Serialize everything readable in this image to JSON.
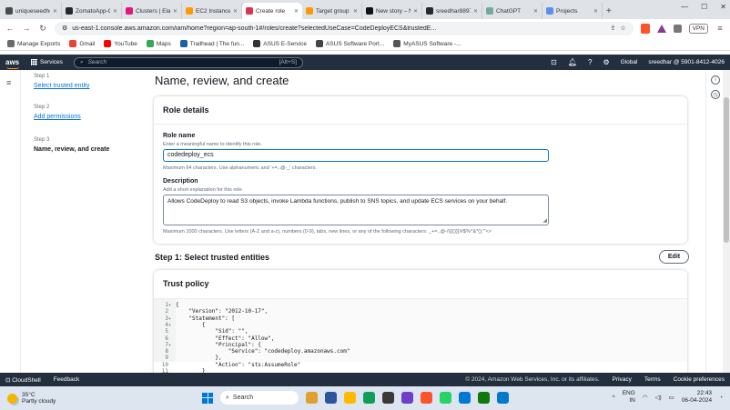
{
  "browser": {
    "tabs": [
      {
        "title": "uniqueseedhe",
        "color": "#4a4a4a",
        "active": false
      },
      {
        "title": "ZomatoApp-C",
        "color": "#24292e",
        "active": false
      },
      {
        "title": "Clusters | Elasti",
        "color": "#e7157b",
        "active": false
      },
      {
        "title": "EC2 Instance C",
        "color": "#ff9900",
        "active": false
      },
      {
        "title": "Create role",
        "color": "#dd344c",
        "active": true
      },
      {
        "title": "Target group d",
        "color": "#ff9900",
        "active": false
      },
      {
        "title": "New story – Me",
        "color": "#111111",
        "active": false
      },
      {
        "title": "sreedhar8897/",
        "color": "#24292e",
        "active": false
      },
      {
        "title": "ChatGPT",
        "color": "#74aa9c",
        "active": false
      },
      {
        "title": "Projects",
        "color": "#5b8def",
        "active": false
      }
    ],
    "url": "us-east-1.console.aws.amazon.com/iam/home?region=ap-south-1#/roles/create?selectedUseCase=CodeDeployECS&trustedE...",
    "vpn_label": "VPN",
    "bookmarks": [
      {
        "label": "Manage Exports",
        "color": "#6b6b6b"
      },
      {
        "label": "Gmail",
        "color": "#ea4335"
      },
      {
        "label": "YouTube",
        "color": "#ff0000"
      },
      {
        "label": "Maps",
        "color": "#34a853"
      },
      {
        "label": "Trailhead | The fun...",
        "color": "#1b5fa6"
      },
      {
        "label": "ASUS E-Service",
        "color": "#333333"
      },
      {
        "label": "ASUS Software Port...",
        "color": "#444444"
      },
      {
        "label": "MyASUS Software -...",
        "color": "#555555"
      }
    ]
  },
  "aws_nav": {
    "logo": "aws",
    "services": "Services",
    "search_placeholder": "Search",
    "search_shortcut": "[Alt+S]",
    "region": "Global",
    "account": "sreedhar @ 5901-8412-4026"
  },
  "wizard": {
    "step1_label": "Step 1",
    "step1_link": "Select trusted entity",
    "step2_label": "Step 2",
    "step2_link": "Add permissions",
    "step3_label": "Step 3",
    "step3_current": "Name, review, and create"
  },
  "main": {
    "page_title": "Name, review, and create",
    "role_details": {
      "header": "Role details",
      "role_name_label": "Role name",
      "role_name_desc": "Enter a meaningful name to identify this role.",
      "role_name_value": "codedeploy_ecs",
      "role_name_hint": "Maximum 64 characters. Use alphanumeric and '+=,.@-_' characters.",
      "description_label": "Description",
      "description_desc": "Add a short explanation for this role.",
      "description_value": "Allows CodeDeploy to read S3 objects, invoke Lambda functions, publish to SNS topics, and update ECS services on your behalf.",
      "description_hint": "Maximum 1000 characters. Use letters (A-Z and a-z), numbers (0-9), tabs, new lines, or any of the following characters: _+=,.@-/\\[{()}]!#$%^&*();'\"<>`"
    },
    "step1_section": {
      "title": "Step 1: Select trusted entities",
      "edit_label": "Edit",
      "trust_policy_header": "Trust policy",
      "code_lines": [
        {
          "n": "1",
          "fold": "▾",
          "text": "{"
        },
        {
          "n": "2",
          "fold": "",
          "text": "    \"Version\": \"2012-10-17\","
        },
        {
          "n": "3",
          "fold": "▾",
          "text": "    \"Statement\": ["
        },
        {
          "n": "4",
          "fold": "▾",
          "text": "        {"
        },
        {
          "n": "5",
          "fold": "",
          "text": "            \"Sid\": \"\","
        },
        {
          "n": "6",
          "fold": "",
          "text": "            \"Effect\": \"Allow\","
        },
        {
          "n": "7",
          "fold": "▾",
          "text": "            \"Principal\": {"
        },
        {
          "n": "8",
          "fold": "",
          "text": "                \"Service\": \"codedeploy.amazonaws.com\""
        },
        {
          "n": "9",
          "fold": "",
          "text": "            },"
        },
        {
          "n": "10",
          "fold": "",
          "text": "            \"Action\": \"sts:AssumeRole\""
        },
        {
          "n": "11",
          "fold": "",
          "text": "        }"
        }
      ]
    }
  },
  "aws_footer": {
    "cloudshell": "CloudShell",
    "feedback": "Feedback",
    "copyright": "© 2024, Amazon Web Services, Inc. or its affiliates.",
    "privacy": "Privacy",
    "terms": "Terms",
    "cookies": "Cookie preferences"
  },
  "taskbar": {
    "temp": "35°C",
    "weather": "Partly cloudy",
    "search": "Search",
    "lang1": "ENG",
    "lang2": "IN",
    "time": "22:43",
    "date": "06-04-2024",
    "apps": [
      "#e0a030",
      "#2b579a",
      "#ffb900",
      "#0f9d58",
      "#3a3a3a",
      "#6e40c9",
      "#fb542b",
      "#25d366",
      "#0078d4",
      "#0e7a0d",
      "#007acc"
    ]
  }
}
